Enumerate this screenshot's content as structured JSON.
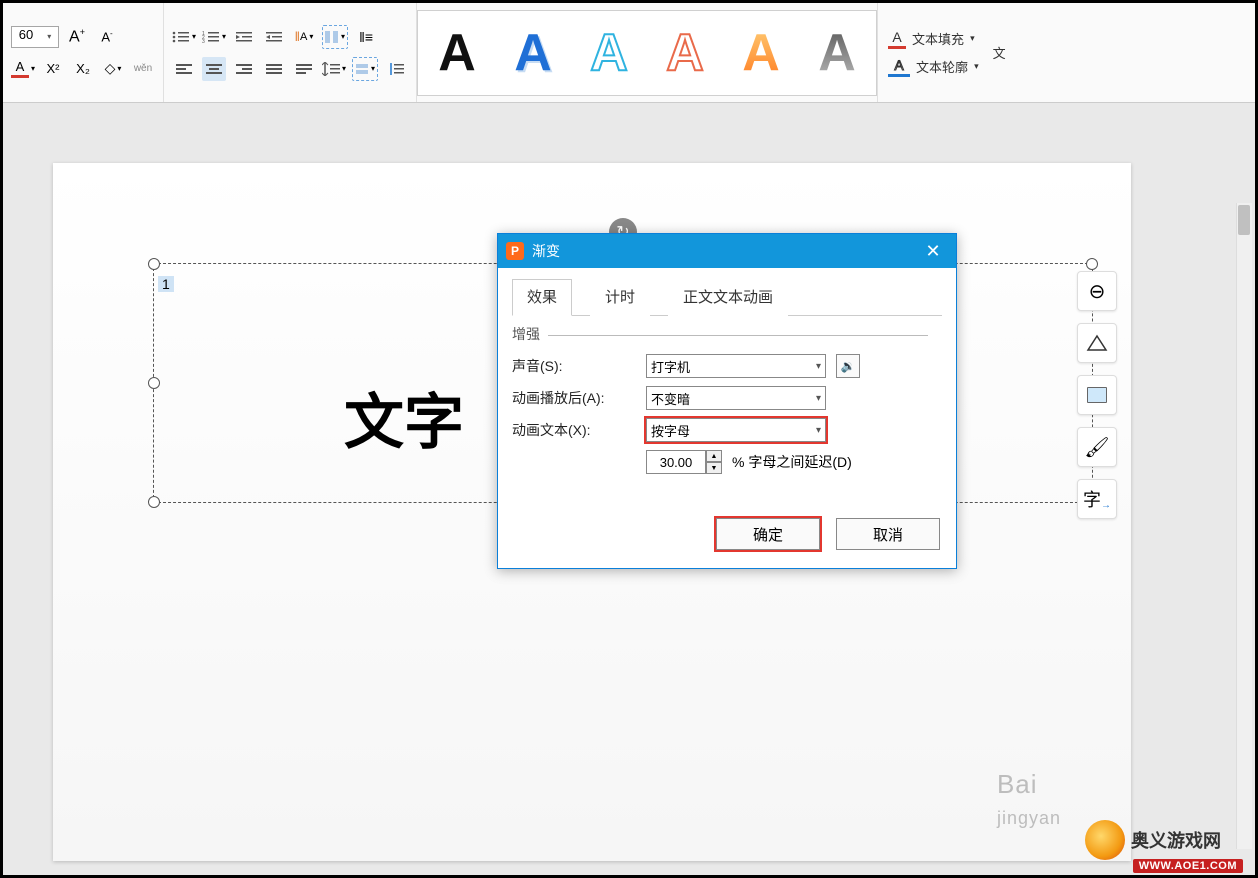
{
  "ribbon": {
    "font_size": "60",
    "text_styles_letter": "A",
    "text_fill_label": "文本填充",
    "text_outline_label": "文本轮廓",
    "text_effects_label": "文"
  },
  "canvas": {
    "textbox_text": "文字",
    "anchor_num": "1"
  },
  "dialog": {
    "title": "渐变",
    "tabs": {
      "effect": "效果",
      "timing": "计时",
      "text_anim": "正文文本动画"
    },
    "section_label": "增强",
    "labels": {
      "sound": "声音(S):",
      "after_anim": "动画播放后(A):",
      "anim_text": "动画文本(X):",
      "delay_label": "% 字母之间延迟(D)"
    },
    "values": {
      "sound": "打字机",
      "after_anim": "不变暗",
      "anim_text": "按字母",
      "delay": "30.00"
    },
    "buttons": {
      "ok": "确定",
      "cancel": "取消"
    }
  },
  "watermark": {
    "brand": "Bai",
    "sub": "jingyan"
  },
  "logo": {
    "text": "奥义游戏网",
    "url": "WWW.AOE1.COM"
  }
}
